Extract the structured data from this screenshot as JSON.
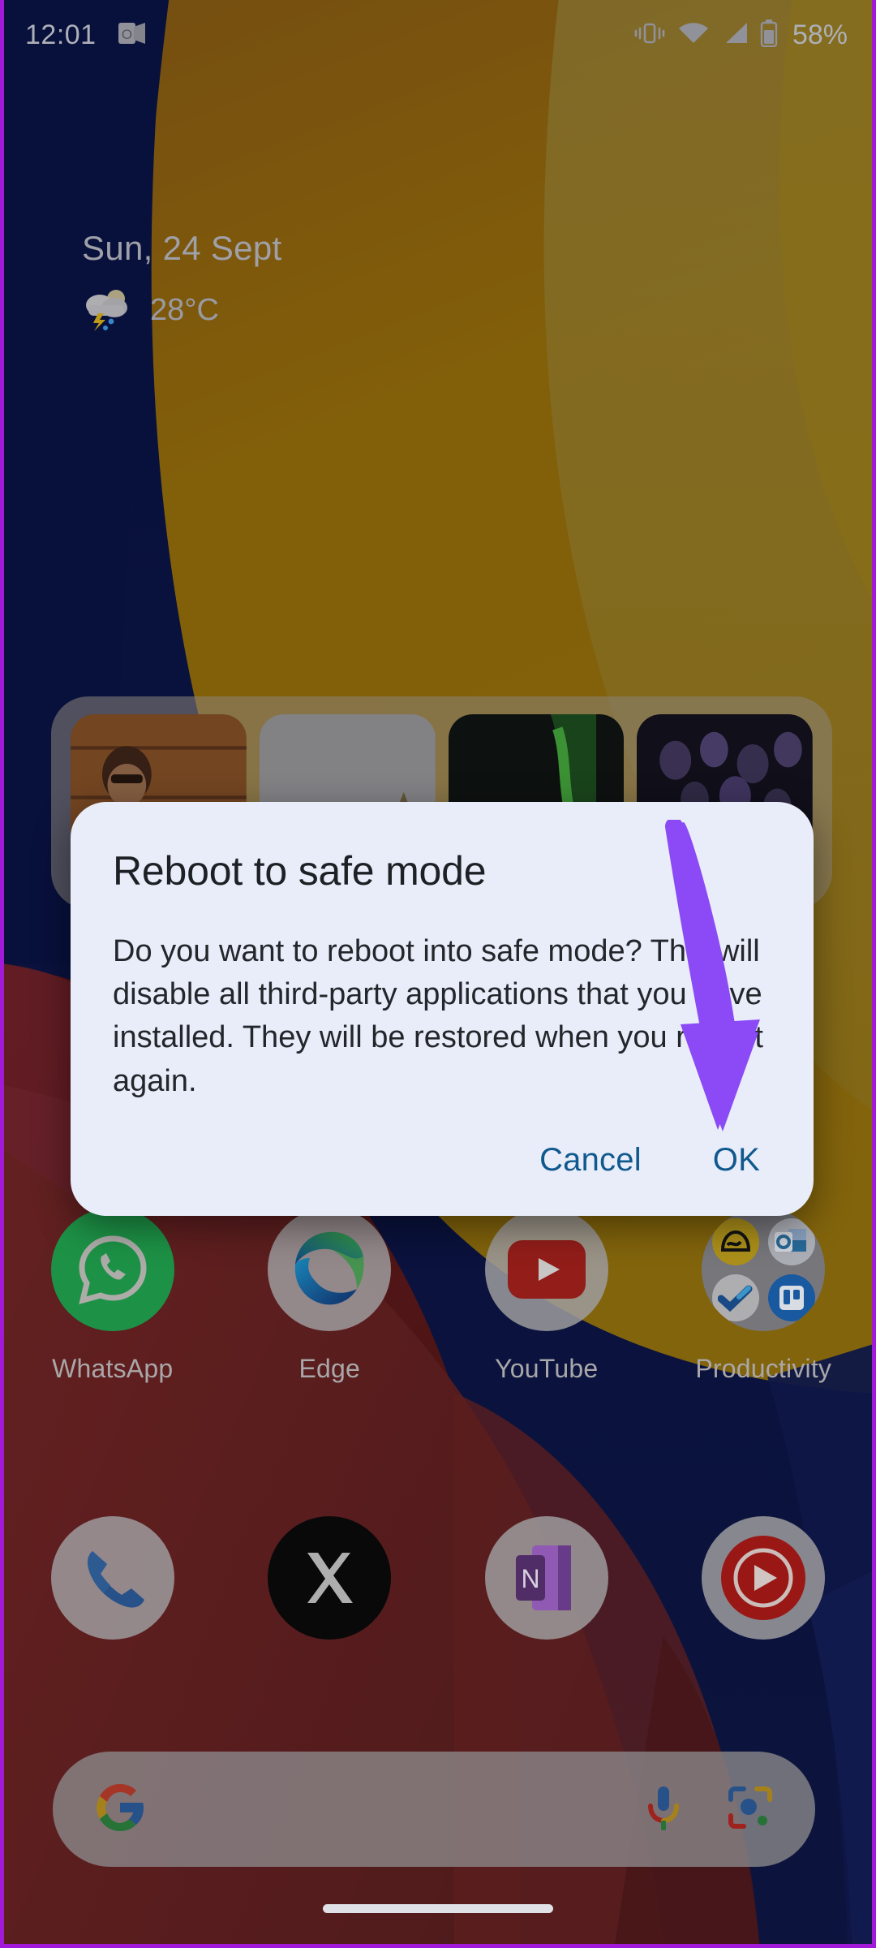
{
  "device": {
    "capture_border_color": "#a21ad8",
    "wallpaper": {
      "base_color": "#0d1b5c",
      "accent_gold": "#c9920f",
      "accent_gold_light": "#cdb254",
      "accent_red": "#8e2424",
      "accent_red_dark": "#5d1f20"
    }
  },
  "statusbar": {
    "clock": "12:01",
    "icons_left": [
      "outlook-icon"
    ],
    "icons_right": [
      "vibrate-icon",
      "wifi-icon",
      "cellular-signal-icon",
      "battery-icon"
    ],
    "battery_percent": "58%",
    "text_color": "#b9bbc4"
  },
  "date_widget": {
    "date": "Sun, 24 Sept",
    "weather_icon": "thunderstorm-cloud-icon",
    "temperature": "28°C"
  },
  "photos_widget": {
    "name": "photos-widget",
    "photo_count": 4,
    "photos": [
      {
        "name": "photo-thumbnail-1",
        "description": "man in light blue shirt against wooden wall"
      },
      {
        "name": "photo-thumbnail-2",
        "description": "woman outdoors under overcast sky"
      },
      {
        "name": "photo-thumbnail-3",
        "description": "dark indoor scene with green lights"
      },
      {
        "name": "photo-thumbnail-4",
        "description": "dark concert scene with purple lights"
      }
    ]
  },
  "dialog": {
    "title": "Reboot to safe mode",
    "body": "Do you want to reboot into safe mode? This will disable all third-party applications that you have installed. They will be restored when you reboot again.",
    "cancel_label": "Cancel",
    "ok_label": "OK",
    "background_color": "#e9edf9",
    "button_color": "#10598f",
    "title_color": "#1d2024"
  },
  "annotation": {
    "type": "arrow",
    "color": "#8b4af5",
    "points_to": "OK"
  },
  "home_screen": {
    "app_row_1": [
      {
        "label": "WhatsApp",
        "icon": "whatsapp-icon"
      },
      {
        "label": "Edge",
        "icon": "microsoft-edge-icon"
      },
      {
        "label": "YouTube",
        "icon": "youtube-icon"
      },
      {
        "label": "Productivity",
        "icon": "folder-icon",
        "folder_apps": [
          "notion-icon",
          "outlook-icon",
          "todoist-icon",
          "trello-icon"
        ]
      }
    ],
    "dock": [
      {
        "label": "",
        "icon": "phone-icon"
      },
      {
        "label": "",
        "icon": "x-twitter-icon"
      },
      {
        "label": "",
        "icon": "onenote-icon"
      },
      {
        "label": "",
        "icon": "youtube-music-icon"
      }
    ]
  },
  "search_bar": {
    "logo": "google-g-icon",
    "placeholder": "",
    "value": "",
    "actions": [
      "microphone-icon",
      "google-lens-icon"
    ]
  },
  "navigation": {
    "home_indicator": "home-gesture-pill"
  }
}
